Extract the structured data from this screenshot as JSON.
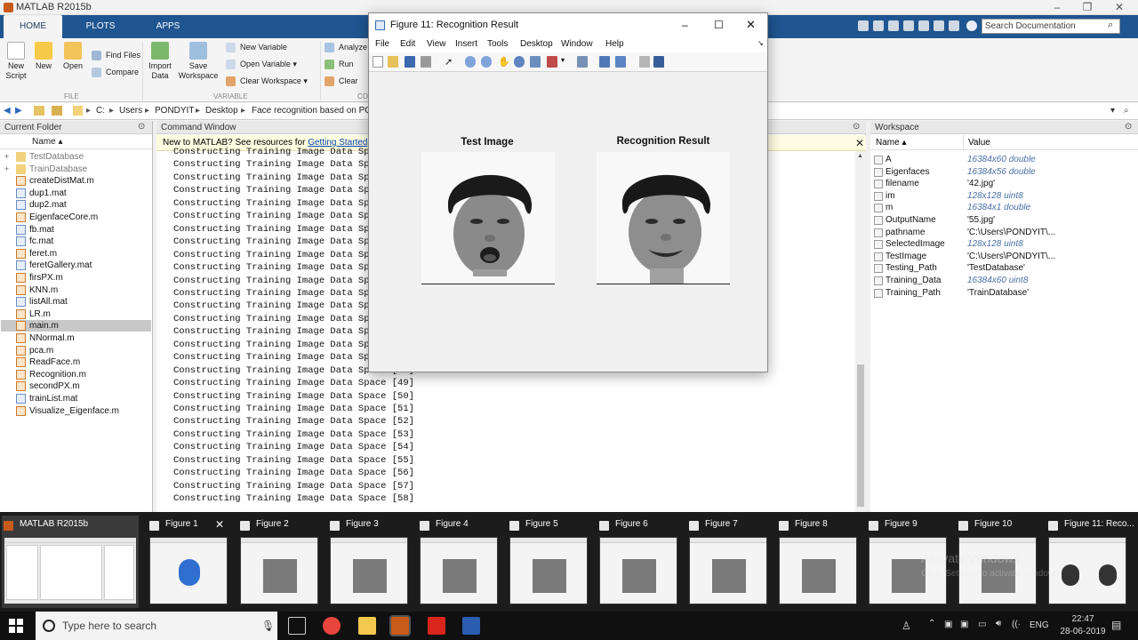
{
  "matlab": {
    "title": "MATLAB R2015b",
    "tabs": [
      "HOME",
      "PLOTS",
      "APPS"
    ],
    "search_placeholder": "Search Documentation",
    "ribbon": {
      "new_script": "New\nScript",
      "new": "New",
      "open": "Open",
      "find_files": "Find Files",
      "compare": "Compare",
      "import_data": "Import\nData",
      "save_workspace": "Save\nWorkspace",
      "new_variable": "New Variable",
      "open_variable": "Open Variable",
      "clear_workspace": "Clear Workspace",
      "analyze": "Analyze",
      "run_and": "Run and",
      "clear_co": "Clear Co",
      "group_file": "FILE",
      "group_variable": "VARIABLE",
      "group_co": "CO"
    },
    "address": [
      "C:",
      "Users",
      "PONDYIT",
      "Desktop",
      "Face recognition based on PCA"
    ],
    "current_folder": {
      "title": "Current Folder",
      "column": "Name ▴",
      "items": [
        {
          "name": "TestDatabase",
          "kind": "folder"
        },
        {
          "name": "TrainDatabase",
          "kind": "folder"
        },
        {
          "name": "createDistMat.m",
          "kind": "m"
        },
        {
          "name": "dup1.mat",
          "kind": "mat"
        },
        {
          "name": "dup2.mat",
          "kind": "mat"
        },
        {
          "name": "EigenfaceCore.m",
          "kind": "m"
        },
        {
          "name": "fb.mat",
          "kind": "mat"
        },
        {
          "name": "fc.mat",
          "kind": "mat"
        },
        {
          "name": "feret.m",
          "kind": "m"
        },
        {
          "name": "feretGallery.mat",
          "kind": "mat"
        },
        {
          "name": "firsPX.m",
          "kind": "m"
        },
        {
          "name": "KNN.m",
          "kind": "m"
        },
        {
          "name": "listAll.mat",
          "kind": "mat"
        },
        {
          "name": "LR.m",
          "kind": "m"
        },
        {
          "name": "main.m",
          "kind": "m"
        },
        {
          "name": "NNormal.m",
          "kind": "m"
        },
        {
          "name": "pca.m",
          "kind": "m"
        },
        {
          "name": "ReadFace.m",
          "kind": "m"
        },
        {
          "name": "Recognition.m",
          "kind": "m"
        },
        {
          "name": "secondPX.m",
          "kind": "m"
        },
        {
          "name": "trainList.mat",
          "kind": "mat"
        },
        {
          "name": "Visualize_Eigenface.m",
          "kind": "m"
        }
      ]
    },
    "command_window": {
      "title": "Command Window",
      "banner_text": "New to MATLAB? See resources for ",
      "banner_link": "Getting Started",
      "banner_end": ".",
      "lines": [
        "Constructing Training Image Data Sp",
        "Constructing Training Image Data Sp",
        "Constructing Training Image Data Sp",
        "Constructing Training Image Data Sp",
        "Constructing Training Image Data Sp",
        "Constructing Training Image Data Sp",
        "Constructing Training Image Data Sp",
        "Constructing Training Image Data Sp",
        "Constructing Training Image Data Sp",
        "Constructing Training Image Data Sp",
        "Constructing Training Image Data Sp",
        "Constructing Training Image Data Sp",
        "Constructing Training Image Data Sp",
        "Constructing Training Image Data Sp",
        "Constructing Training Image Data Sp",
        "Constructing Training Image Data Sp",
        "Constructing Training Image Data Sp",
        "Constructing Training Image Data Space [48]",
        "Constructing Training Image Data Space [49]",
        "Constructing Training Image Data Space [50]",
        "Constructing Training Image Data Space [51]",
        "Constructing Training Image Data Space [52]",
        "Constructing Training Image Data Space [53]",
        "Constructing Training Image Data Space [54]",
        "Constructing Training Image Data Space [55]",
        "Constructing Training Image Data Space [56]",
        "Constructing Training Image Data Space [57]",
        "Constructing Training Image Data Space [58]"
      ]
    },
    "workspace": {
      "title": "Workspace",
      "col_name": "Name ▴",
      "col_value": "Value",
      "rows": [
        {
          "name": "A",
          "value": "16384x60 double",
          "italic": true
        },
        {
          "name": "Eigenfaces",
          "value": "16384x56 double",
          "italic": true
        },
        {
          "name": "filename",
          "value": "'42.jpg'",
          "italic": false
        },
        {
          "name": "im",
          "value": "128x128 uint8",
          "italic": true
        },
        {
          "name": "m",
          "value": "16384x1 double",
          "italic": true
        },
        {
          "name": "OutputName",
          "value": "'55.jpg'",
          "italic": false
        },
        {
          "name": "pathname",
          "value": "'C:\\Users\\PONDYIT\\...",
          "italic": false
        },
        {
          "name": "SelectedImage",
          "value": "128x128 uint8",
          "italic": true
        },
        {
          "name": "TestImage",
          "value": "'C:\\Users\\PONDYIT\\...",
          "italic": false
        },
        {
          "name": "Testing_Path",
          "value": "'TestDatabase'",
          "italic": false
        },
        {
          "name": "Training_Data",
          "value": "16384x60 uint8",
          "italic": true
        },
        {
          "name": "Training_Path",
          "value": "'TrainDatabase'",
          "italic": false
        }
      ]
    }
  },
  "figure": {
    "title": "Figure 11: Recognition Result",
    "menu": [
      "File",
      "Edit",
      "View",
      "Insert",
      "Tools",
      "Desktop",
      "Window",
      "Help"
    ],
    "left_title": "Test Image",
    "right_title": "Recognition Result"
  },
  "thumbnails": [
    {
      "label": "MATLAB R2015b",
      "kind": "matlab"
    },
    {
      "label": "Figure 1",
      "kind": "face-blue"
    },
    {
      "label": "Figure 2",
      "kind": "eigen"
    },
    {
      "label": "Figure 3",
      "kind": "eigen"
    },
    {
      "label": "Figure 4",
      "kind": "eigen"
    },
    {
      "label": "Figure 5",
      "kind": "eigen"
    },
    {
      "label": "Figure 6",
      "kind": "eigen"
    },
    {
      "label": "Figure 7",
      "kind": "eigen"
    },
    {
      "label": "Figure 8",
      "kind": "eigen"
    },
    {
      "label": "Figure 9",
      "kind": "eigen"
    },
    {
      "label": "Figure 10",
      "kind": "eigen"
    },
    {
      "label": "Figure 11: Reco...",
      "kind": "faces"
    }
  ],
  "watermark": {
    "line1": "Activate Windows",
    "line2": "Go to Settings to activate Windows."
  },
  "taskbar": {
    "search_placeholder": "Type here to search",
    "language": "ENG",
    "time": "22:47",
    "date": "28-06-2019"
  },
  "colors": {
    "ribbon_blue": "#1f5590",
    "link": "#0645ad",
    "workspace_italic": "#4a6ea8"
  }
}
